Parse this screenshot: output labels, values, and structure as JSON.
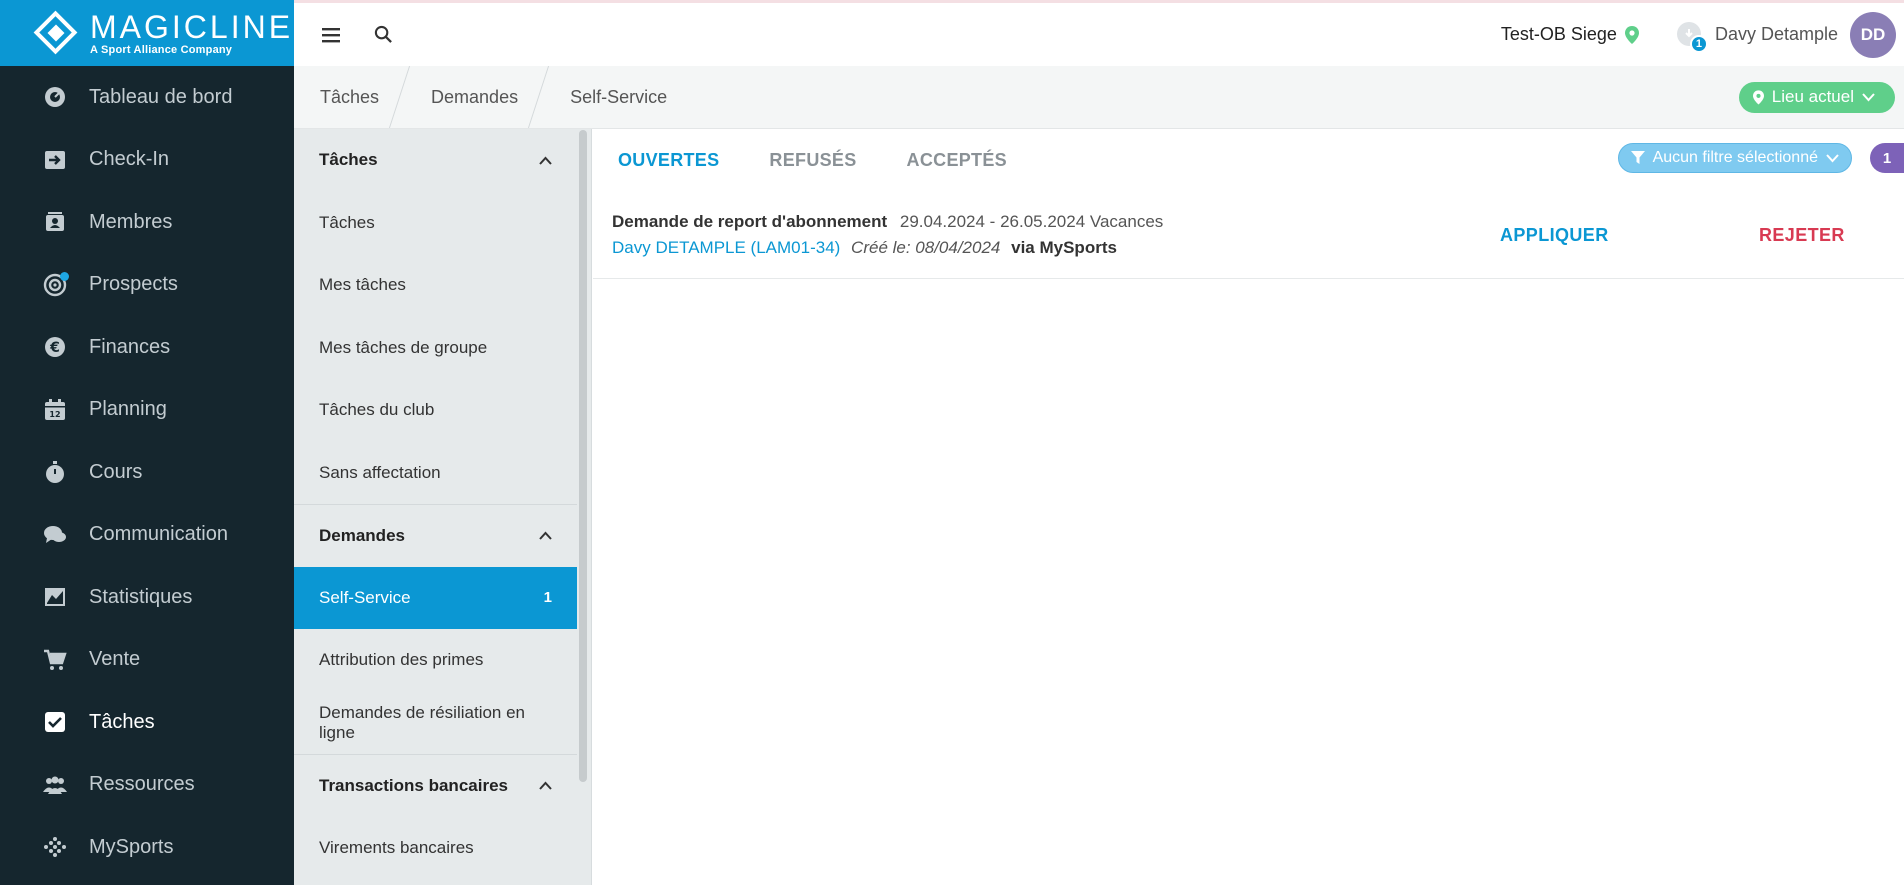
{
  "brand": {
    "name": "MAGICLINE",
    "tagline": "A Sport Alliance Company"
  },
  "nav": {
    "items": [
      {
        "label": "Tableau de bord",
        "icon": "dashboard-icon"
      },
      {
        "label": "Check-In",
        "icon": "check-in-icon"
      },
      {
        "label": "Membres",
        "icon": "members-icon"
      },
      {
        "label": "Prospects",
        "icon": "prospects-icon"
      },
      {
        "label": "Finances",
        "icon": "euro-icon"
      },
      {
        "label": "Planning",
        "icon": "calendar-icon"
      },
      {
        "label": "Cours",
        "icon": "stopwatch-icon"
      },
      {
        "label": "Communication",
        "icon": "chat-icon"
      },
      {
        "label": "Statistiques",
        "icon": "chart-icon"
      },
      {
        "label": "Vente",
        "icon": "cart-icon"
      },
      {
        "label": "Tâches",
        "icon": "checkbox-icon"
      },
      {
        "label": "Ressources",
        "icon": "people-icon"
      },
      {
        "label": "MySports",
        "icon": "mysports-icon"
      }
    ],
    "active": "Tâches"
  },
  "header": {
    "location": "Test-OB Siege",
    "notification_count": "1",
    "user_name": "Davy Detample",
    "avatar_initials": "DD"
  },
  "breadcrumb": {
    "items": [
      "Tâches",
      "Demandes",
      "Self-Service"
    ],
    "location_button": "Lieu actuel"
  },
  "subnav": {
    "sections": [
      {
        "title": "Tâches",
        "items": [
          "Tâches",
          "Mes tâches",
          "Mes tâches de groupe",
          "Tâches du club",
          "Sans affectation"
        ]
      },
      {
        "title": "Demandes",
        "items": [
          "Self-Service",
          "Attribution des primes",
          "Demandes de résiliation en ligne"
        ],
        "active_count": "1"
      },
      {
        "title": "Transactions bancaires",
        "items": [
          "Virements bancaires"
        ]
      }
    ]
  },
  "main": {
    "tabs": [
      "OUVERTES",
      "REFUSÉS",
      "ACCEPTÉS"
    ],
    "active_tab": "OUVERTES",
    "filter_label": "Aucun filtre sélectionné",
    "count": "1",
    "requests": [
      {
        "title": "Demande de report d'abonnement",
        "period": "29.04.2024 - 26.05.2024 Vacances",
        "member": "Davy DETAMPLE (LAM01-34)",
        "created": "Créé le: 08/04/2024",
        "via": "via MySports",
        "apply_label": "APPLIQUER",
        "reject_label": "REJETER"
      }
    ]
  },
  "colors": {
    "primary": "#0b97d3",
    "sidebar": "#15262e",
    "green": "#5fcf8a",
    "reject": "#d83a52",
    "avatar": "#8a7eb5"
  }
}
